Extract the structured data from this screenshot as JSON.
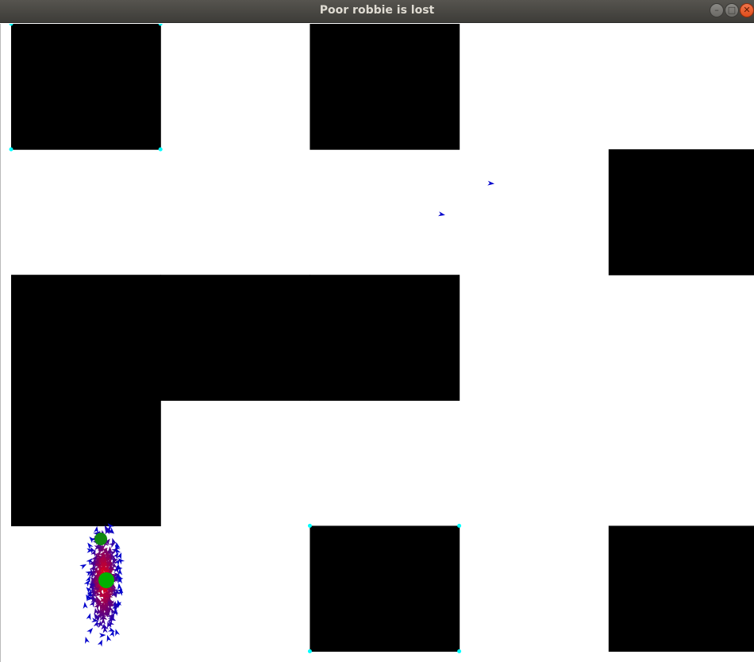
{
  "window": {
    "title": "Poor robbie is lost",
    "buttons": [
      {
        "name": "minimize-button",
        "glyph": "–"
      },
      {
        "name": "maximize-button",
        "glyph": "□"
      },
      {
        "name": "close-button",
        "glyph": "✕"
      }
    ]
  },
  "colors": {
    "wall": "#000000",
    "floor": "#ffffff",
    "corner_marker": "#00ffff",
    "robot_marker": "#00b000",
    "particle_high_weight": "#ff0000",
    "particle_low_weight": "#0000cc"
  },
  "world": {
    "grid_columns": 5,
    "grid_rows": 5,
    "wall_cells": [
      {
        "col": 0,
        "row": 0
      },
      {
        "col": 2,
        "row": 0
      },
      {
        "col": 4,
        "row": 1
      },
      {
        "col": 0,
        "row": 2
      },
      {
        "col": 1,
        "row": 2
      },
      {
        "col": 2,
        "row": 2
      },
      {
        "col": 0,
        "row": 3
      },
      {
        "col": 2,
        "row": 4
      },
      {
        "col": 4,
        "row": 4
      }
    ],
    "marked_corner_cells": [
      {
        "col": 0,
        "row": 0
      },
      {
        "col": 2,
        "row": 4
      }
    ]
  }
}
